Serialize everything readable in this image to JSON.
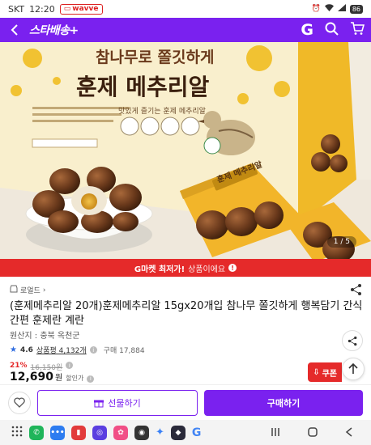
{
  "status_bar": {
    "carrier": "SKT",
    "time": "12:20",
    "app_badge": "wavve",
    "battery": "86"
  },
  "app_bar": {
    "brand": "스타배송+",
    "g_label": "G"
  },
  "hero": {
    "box_tagline": "참나무로 쫄깃하게",
    "box_title": "훈제 메추리알",
    "box_sub": "맛있게 즐기는 훈제 메추리알",
    "pouch_label": "훈제 메추리알",
    "pager": "1 / 5"
  },
  "promo": {
    "bold": "G마켓 최저가!",
    "sub": "상품이에요",
    "info": "!"
  },
  "product": {
    "seller": "로얼드",
    "title": "(훈제메추리알 20개)훈제메추리알 15gx20개입 참나무 쫄깃하게 행복담기 간식 간편 훈제란 계란",
    "origin": "원산지 : 충북 옥천군",
    "rating": "4.6",
    "reviews": "상품평 4,132개",
    "sold": "구매 17,884",
    "discount_pct": "21%",
    "original_price": "16,150원",
    "price": "12,690",
    "currency": "원",
    "price_note": "할인가",
    "coupon": "쿠폰"
  },
  "actions": {
    "gift": "선물하기",
    "buy": "구매하기"
  },
  "colors": {
    "brand": "#7a21ef",
    "promo": "#e52a2a"
  }
}
